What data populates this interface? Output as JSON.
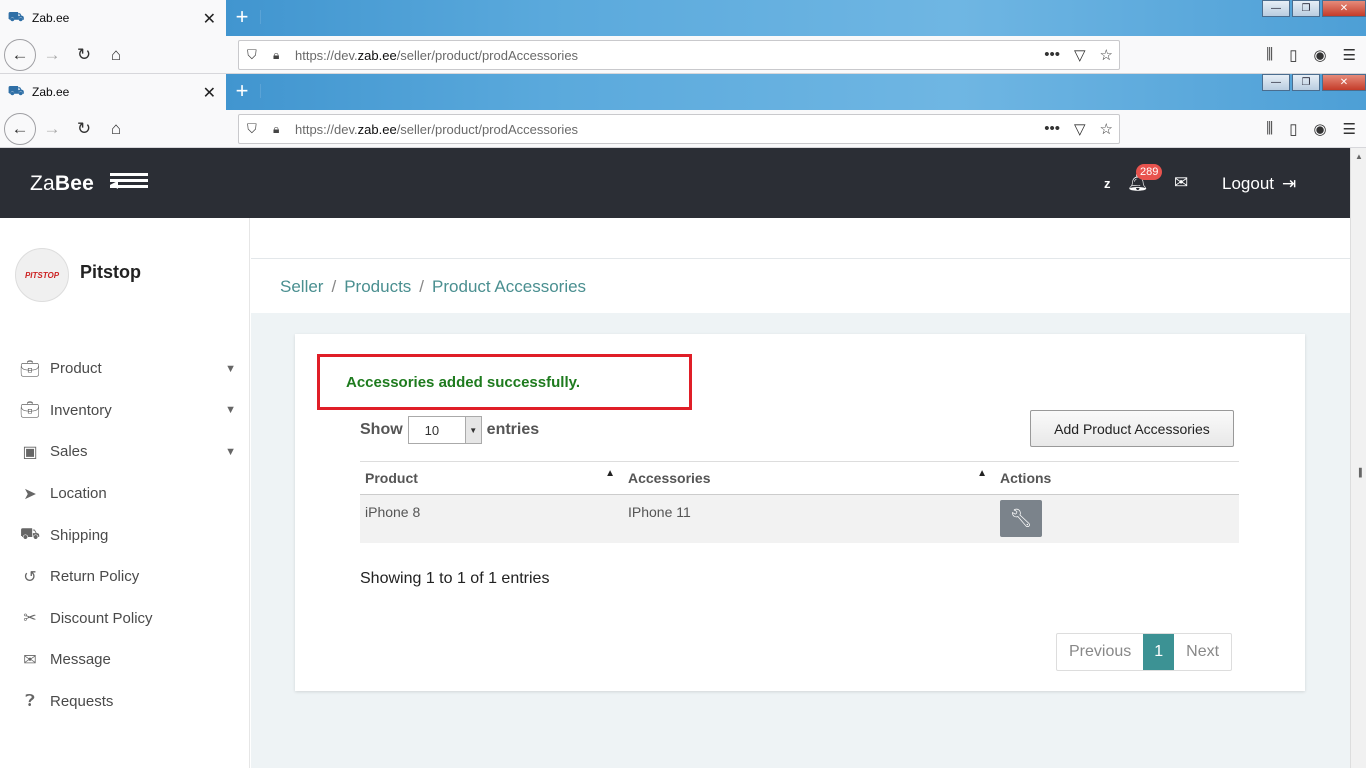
{
  "browser": {
    "tab_title": "Zab.ee",
    "url_prefix": "https://dev.",
    "url_domain": "zab.ee",
    "url_path": "/seller/product/prodAccessories"
  },
  "header": {
    "brand_light": "Za",
    "brand_bold": "Bee",
    "user_initial": "z",
    "notification_count": "289",
    "logout_label": "Logout"
  },
  "sidebar": {
    "shop_name": "Pitstop",
    "logo_text_a": "PITSTOP",
    "logo_text_b": "▸",
    "items": [
      {
        "label": "Product",
        "icon": "briefcase-icon"
      },
      {
        "label": "Inventory",
        "icon": "briefcase-icon"
      },
      {
        "label": "Sales",
        "icon": "money-icon"
      },
      {
        "label": "Location",
        "icon": "location-arrow-icon"
      },
      {
        "label": "Shipping",
        "icon": "truck-icon"
      },
      {
        "label": "Return Policy",
        "icon": "undo-icon"
      },
      {
        "label": "Discount Policy",
        "icon": "scissors-icon"
      },
      {
        "label": "Message",
        "icon": "envelope-icon"
      },
      {
        "label": "Requests",
        "icon": "question-circle-icon"
      }
    ]
  },
  "breadcrumb": {
    "items": [
      "Seller",
      "Products",
      "Product Accessories"
    ],
    "separator": "/"
  },
  "content": {
    "alert": "Accessories added successfully.",
    "show_label": "Show",
    "entries_value": "10",
    "entries_label": "entries",
    "add_button": "Add Product Accessories",
    "columns": [
      "Product",
      "Accessories",
      "Actions"
    ],
    "rows": [
      {
        "product": "iPhone 8",
        "accessories": "IPhone 11"
      }
    ],
    "info": "Showing 1 to 1 of 1 entries",
    "pager": {
      "previous": "Previous",
      "current": "1",
      "next": "Next"
    }
  },
  "colors": {
    "topbar": "#2b2e35",
    "accent": "#3c9294",
    "alert_border": "#e01e27",
    "alert_text": "#1e7b1e"
  }
}
